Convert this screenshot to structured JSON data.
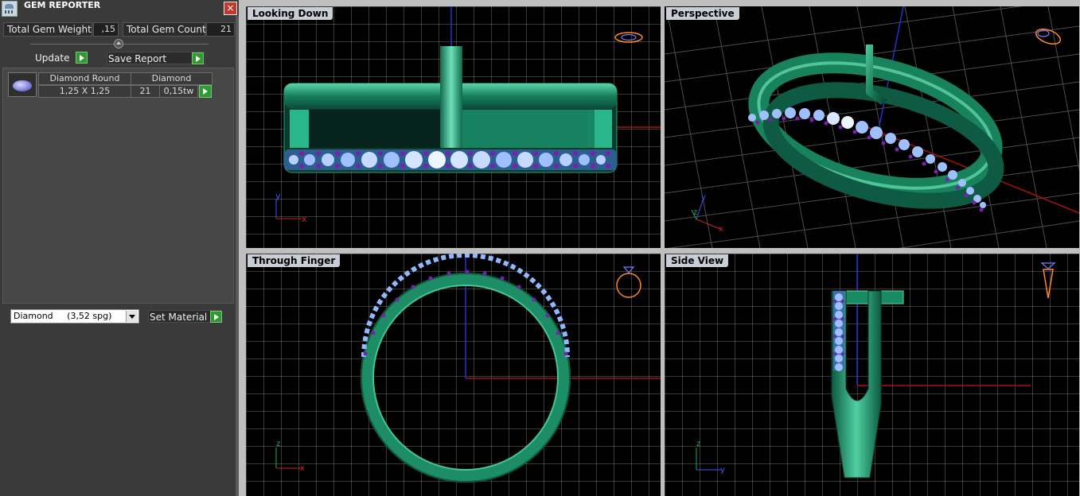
{
  "window": {
    "title": "GEM REPORTER",
    "close_label": "×",
    "app_icon": "gem-reporter-icon"
  },
  "totals": {
    "weight_label": "Total Gem Weight",
    "weight_value": ",15",
    "count_label": "Total Gem Count",
    "count_value": "21"
  },
  "slider": {
    "level": 0.5
  },
  "buttons": {
    "update": "Update",
    "save_report": "Save Report",
    "set_material": "Set Material"
  },
  "gem_list": [
    {
      "thumb_icon": "oval-gem-icon",
      "name": "Diamond Round",
      "size": "1,25 X 1,25",
      "material": "Diamond",
      "count": "21",
      "weight": "0,15tw"
    }
  ],
  "material_select": {
    "selected": "Diamond     (3,52 spg)"
  },
  "viewports": {
    "top": "Looking Down",
    "perspective": "Perspective",
    "front": "Through Finger",
    "side": "Side View"
  },
  "axes": {
    "x": "x",
    "y": "y",
    "z": "z"
  },
  "colors": {
    "metal": "#1f8f6a",
    "gem_stones": "#8fb8ff",
    "prongs": "#7a1fb0",
    "grid": "#5a5a5a",
    "close_button": "#c0392b",
    "play_button": "#2f9a2f"
  }
}
